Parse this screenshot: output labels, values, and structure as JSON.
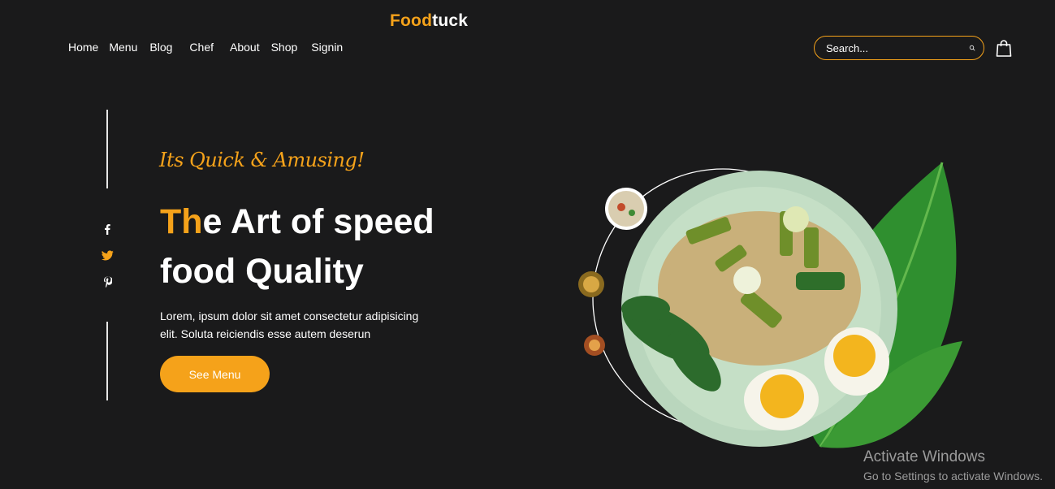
{
  "brand": {
    "part1": "Food",
    "part2": "tuck"
  },
  "nav": [
    {
      "label": "Home"
    },
    {
      "label": "Menu"
    },
    {
      "label": "Blog"
    },
    {
      "label": "Chef"
    },
    {
      "label": "About"
    },
    {
      "label": "Shop"
    },
    {
      "label": "Signin"
    }
  ],
  "search": {
    "placeholder": "Search..."
  },
  "social": [
    "facebook-icon",
    "twitter-icon",
    "pinterest-icon"
  ],
  "hero": {
    "tagline": "Its Quick & Amusing!",
    "headline_accent": "Th",
    "headline_rest_1": "e Art of speed",
    "headline_line2": "food Quality",
    "description": "Lorem, ipsum dolor sit amet consectetur adipisicing elit. Soluta reiciendis esse autem deserun",
    "cta_label": "See Menu"
  },
  "colors": {
    "accent": "#f5a21a",
    "background": "#1a1a1b"
  },
  "os_watermark": {
    "title": "Activate Windows",
    "subtitle": "Go to Settings to activate Windows."
  }
}
